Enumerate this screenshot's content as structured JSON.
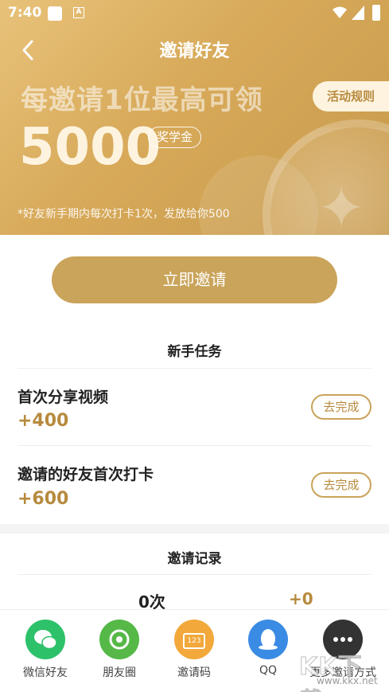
{
  "status_bar": {
    "time": "7:40",
    "a_icon": "A"
  },
  "nav": {
    "title": "邀请好友"
  },
  "hero": {
    "headline": "每邀请1位最高可领",
    "amount": "5000",
    "badge": "奖学金",
    "rules_button": "活动规则",
    "note": "*好友新手期内每次打卡1次，发放给你500"
  },
  "invite_button": "立即邀请",
  "tasks": {
    "title": "新手任务",
    "items": [
      {
        "name": "首次分享视频",
        "reward": "+400",
        "action": "去完成"
      },
      {
        "name": "邀请的好友首次打卡",
        "reward": "+600",
        "action": "去完成"
      }
    ]
  },
  "records": {
    "title": "邀请记录",
    "count": "0次",
    "bonus": "+0"
  },
  "share": {
    "items": [
      {
        "label": "微信好友",
        "icon": "wechat-icon",
        "color": "#2dc16a"
      },
      {
        "label": "朋友圈",
        "icon": "moments-icon",
        "color": "#55b847"
      },
      {
        "label": "邀请码",
        "icon": "ticket-icon",
        "color": "#f2a83b",
        "glyph": "123"
      },
      {
        "label": "QQ",
        "icon": "qq-icon",
        "color": "#3a8be4"
      },
      {
        "label": "更多邀请方式",
        "icon": "more-icon",
        "color": "#333333"
      }
    ]
  },
  "watermark": {
    "big": "KK下载",
    "small": "www.kkx.net"
  },
  "colors": {
    "gold": "#c9a45a",
    "gold_text": "#b78a3e",
    "hero_start": "#e8c27a",
    "hero_end": "#c79a4c"
  }
}
